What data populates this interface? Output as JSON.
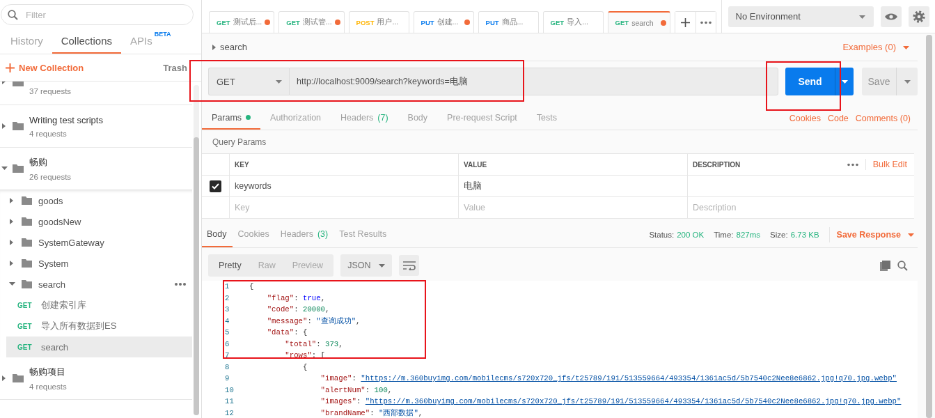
{
  "sidebar": {
    "filter": {
      "placeholder": "Filter"
    },
    "tabs": [
      {
        "label": "History",
        "selected": false
      },
      {
        "label": "Collections",
        "selected": true
      },
      {
        "label": "APIs",
        "badge": "BETA",
        "selected": false
      }
    ],
    "new_collection": "New Collection",
    "trash": "Trash",
    "collections": [
      {
        "count": "37 requests",
        "expanded": false
      },
      {
        "name": "Writing test scripts",
        "count": "4 requests",
        "expanded": false
      },
      {
        "name": "畅购",
        "count": "26 requests",
        "expanded": true,
        "children": [
          {
            "name": "goods",
            "expanded": false,
            "hovered": false
          },
          {
            "name": "goodsNew",
            "expanded": false,
            "hovered": false
          },
          {
            "name": "SystemGateway",
            "expanded": false,
            "hovered": false
          },
          {
            "name": "System",
            "expanded": false,
            "hovered": false
          },
          {
            "name": "search",
            "expanded": true,
            "hovered": true,
            "children": [
              {
                "method": "GET",
                "color": "#26b47f",
                "name": "创建索引库",
                "selected": false
              },
              {
                "method": "GET",
                "color": "#26b47f",
                "name": "导入所有数据到ES",
                "selected": false
              },
              {
                "method": "GET",
                "color": "#26b47f",
                "name": "search",
                "selected": true
              }
            ]
          }
        ]
      },
      {
        "name": "畅购项目",
        "count": "4 requests",
        "expanded": false
      }
    ]
  },
  "request_tabs": [
    {
      "method": "GET",
      "color": "#26b47f",
      "title": "测试后...",
      "unsaved": true,
      "selected": false
    },
    {
      "method": "GET",
      "color": "#26b47f",
      "title": "测试管...",
      "unsaved": true,
      "selected": false
    },
    {
      "method": "POST",
      "color": "#ffb400",
      "title": "用户...",
      "unsaved": false,
      "selected": false
    },
    {
      "method": "PUT",
      "color": "#097bed",
      "title": "创建...",
      "unsaved": true,
      "selected": false
    },
    {
      "method": "PUT",
      "color": "#097bed",
      "title": "商品...",
      "unsaved": false,
      "selected": false
    },
    {
      "method": "GET",
      "color": "#26b47f",
      "title": "导入...",
      "unsaved": false,
      "selected": false
    },
    {
      "method": "GET",
      "color": "#26b47f",
      "title": "search",
      "unsaved": true,
      "selected": true
    }
  ],
  "environment": {
    "value": "No Environment"
  },
  "request": {
    "name": "search",
    "examples": "Examples (0)",
    "method": "GET",
    "url": "http://localhost:9009/search?keywords=电脑",
    "send": "Send",
    "save": "Save",
    "tabs": [
      {
        "label": "Params",
        "dot": true,
        "selected": true
      },
      {
        "label": "Authorization",
        "dot": false,
        "selected": false
      },
      {
        "label": "Headers",
        "count": "(7)",
        "dot": false,
        "selected": false
      },
      {
        "label": "Body",
        "dot": false,
        "selected": false
      },
      {
        "label": "Pre-request Script",
        "dot": false,
        "selected": false
      },
      {
        "label": "Tests",
        "dot": false,
        "selected": false
      }
    ],
    "links": [
      "Cookies",
      "Code",
      "Comments (0)"
    ],
    "params_title": "Query Params",
    "params": {
      "columns": [
        "KEY",
        "VALUE",
        "DESCRIPTION"
      ],
      "bulk_edit": "Bulk Edit",
      "rows": [
        {
          "checked": true,
          "key": "keywords",
          "value": "电脑"
        }
      ],
      "new_row": {
        "key": {
          "placeholder": "Key"
        },
        "value": {
          "placeholder": "Value"
        },
        "description": {
          "placeholder": "Description"
        }
      }
    }
  },
  "response": {
    "tabs": [
      {
        "label": "Body",
        "selected": true
      },
      {
        "label": "Cookies",
        "selected": false
      },
      {
        "label": "Headers",
        "count": "(3)",
        "selected": false
      },
      {
        "label": "Test Results",
        "selected": false
      }
    ],
    "status_label": "Status:",
    "status": "200 OK",
    "time_label": "Time:",
    "time": "827ms",
    "size_label": "Size:",
    "size": "6.73 KB",
    "save_response": "Save Response",
    "views": [
      {
        "label": "Pretty",
        "selected": true
      },
      {
        "label": "Raw",
        "selected": false
      },
      {
        "label": "Preview",
        "selected": false
      }
    ],
    "format": "JSON",
    "lines": [
      {
        "number": "1",
        "tokens": [
          {
            "kind": "punct",
            "text": "{"
          }
        ]
      },
      {
        "number": "2",
        "tokens": [
          {
            "kind": "key",
            "text": "    \"flag\""
          },
          {
            "kind": "punct",
            "text": ": "
          },
          {
            "kind": "bool",
            "text": "true"
          },
          {
            "kind": "punct",
            "text": ","
          }
        ]
      },
      {
        "number": "3",
        "tokens": [
          {
            "kind": "key",
            "text": "    \"code\""
          },
          {
            "kind": "punct",
            "text": ": "
          },
          {
            "kind": "number",
            "text": "20000"
          },
          {
            "kind": "punct",
            "text": ","
          }
        ]
      },
      {
        "number": "4",
        "tokens": [
          {
            "kind": "key",
            "text": "    \"message\""
          },
          {
            "kind": "punct",
            "text": ": "
          },
          {
            "kind": "string",
            "text": "\"查询成功\""
          },
          {
            "kind": "punct",
            "text": ","
          }
        ]
      },
      {
        "number": "5",
        "tokens": [
          {
            "kind": "key",
            "text": "    \"data\""
          },
          {
            "kind": "punct",
            "text": ": {"
          }
        ]
      },
      {
        "number": "6",
        "tokens": [
          {
            "kind": "key",
            "text": "        \"total\""
          },
          {
            "kind": "punct",
            "text": ": "
          },
          {
            "kind": "number",
            "text": "373"
          },
          {
            "kind": "punct",
            "text": ","
          }
        ]
      },
      {
        "number": "7",
        "tokens": [
          {
            "kind": "key",
            "text": "        \"rows\""
          },
          {
            "kind": "punct",
            "text": ": ["
          }
        ]
      },
      {
        "number": "8",
        "tokens": [
          {
            "kind": "punct",
            "text": "            {"
          }
        ]
      },
      {
        "number": "9",
        "tokens": [
          {
            "kind": "key",
            "text": "                \"image\""
          },
          {
            "kind": "punct",
            "text": ": "
          },
          {
            "kind": "link",
            "text": "\"https://m.360buyimg.com/mobilecms/s720x720_jfs/t25789/191/513559664/493354/1361ac5d/5b7540c2Nee8e6862.jpg!q70.jpg.webp\""
          }
        ]
      },
      {
        "number": "10",
        "tokens": [
          {
            "kind": "key",
            "text": "                \"alertNum\""
          },
          {
            "kind": "punct",
            "text": ": "
          },
          {
            "kind": "number",
            "text": "100"
          },
          {
            "kind": "punct",
            "text": ","
          }
        ]
      },
      {
        "number": "11",
        "tokens": [
          {
            "kind": "key",
            "text": "                \"images\""
          },
          {
            "kind": "punct",
            "text": ": "
          },
          {
            "kind": "link",
            "text": "\"https://m.360buyimg.com/mobilecms/s720x720_jfs/t25789/191/513559664/493354/1361ac5d/5b7540c2Nee8e6862.jpg!q70.jpg.webp\""
          }
        ]
      },
      {
        "number": "12",
        "tokens": [
          {
            "kind": "key",
            "text": "                \"brandName\""
          },
          {
            "kind": "punct",
            "text": ": "
          },
          {
            "kind": "string",
            "text": "\"西部数据\""
          },
          {
            "kind": "punct",
            "text": ","
          }
        ]
      }
    ]
  }
}
